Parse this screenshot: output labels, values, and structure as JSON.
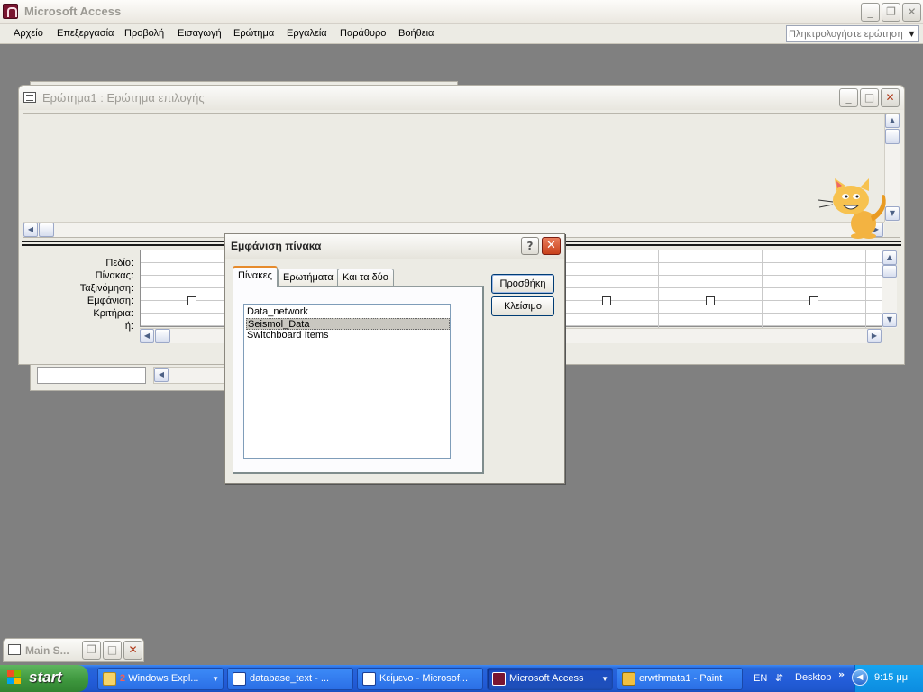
{
  "app": {
    "title": "Microsoft Access"
  },
  "menubar": {
    "items": [
      "Αρχείο",
      "Επεξεργασία",
      "Προβολή",
      "Εισαγωγή",
      "Ερώτημα",
      "Εργαλεία",
      "Παράθυρο",
      "Βοήθεια"
    ],
    "help_placeholder": "Πληκτρολογήστε ερώτηση"
  },
  "query_window": {
    "title": "Ερώτημα1 : Ερώτημα επιλογής",
    "row_labels": [
      "Πεδίο:",
      "Πίνακας:",
      "Ταξινόμηση:",
      "Εμφάνιση:",
      "Κριτήρια:",
      "ή:"
    ]
  },
  "dialog": {
    "title": "Εμφάνιση πίνακα",
    "help_glyph": "?",
    "close_glyph": "✕",
    "tabs": [
      "Πίνακες",
      "Ερωτήματα",
      "Και τα δύο"
    ],
    "active_tab": "Πίνακες",
    "tables": [
      "Data_network",
      "Seismol_Data",
      "Switchboard Items"
    ],
    "selected_table": "Seismol_Data",
    "add_button": "Προσθήκη",
    "close_button": "Κλείσιμο"
  },
  "minimized_window": {
    "title": "Main S..."
  },
  "taskbar": {
    "start_label": "start",
    "tasks": [
      {
        "badge": "2",
        "label": "Windows Expl...",
        "icon": "folder-icon"
      },
      {
        "label": "database_text - ...",
        "icon": "word-icon"
      },
      {
        "label": "Κείμενο - Microsof...",
        "icon": "word-icon"
      },
      {
        "label": "Microsoft Access",
        "icon": "access-icon",
        "active": true
      },
      {
        "label": "erwthmata1 - Paint",
        "icon": "paint-icon"
      }
    ],
    "language": "EN",
    "desktop_label": "Desktop",
    "clock": "9:15 μμ"
  },
  "colors": {
    "taskbar": "#245edb",
    "start": "#3c953c",
    "tray": "#0c8ce0",
    "close_red": "#c8401b",
    "desktop": "#808080"
  }
}
